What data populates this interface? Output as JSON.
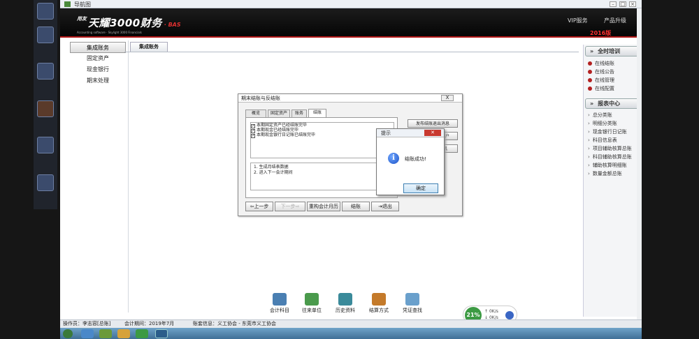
{
  "window": {
    "title": "导航图"
  },
  "banner": {
    "brand_small": "用友",
    "product": "天耀3000财务",
    "edition": "· BAS",
    "tagline": "Accounting software · Skylight 3000 Financials",
    "vip": "VIP服务",
    "upgrade": "产品升级",
    "year": "2016版"
  },
  "left_nav": {
    "items": [
      {
        "label": "集成账务",
        "active": true
      },
      {
        "label": "固定资产",
        "active": false
      },
      {
        "label": "现金银行",
        "active": false
      },
      {
        "label": "期末处理",
        "active": false
      }
    ]
  },
  "main_tab": {
    "label": "集成账务"
  },
  "right_panel": {
    "section1": {
      "title": "全时培训",
      "items": [
        "在线结账",
        "在线公告",
        "在线管理",
        "在线配置"
      ]
    },
    "section2": {
      "title": "报表中心",
      "items": [
        "总分类账",
        "明细分类账",
        "现金银行日记账",
        "科目信息表",
        "项目辅助核算总账",
        "科目辅助核算总账",
        "辅助核算明细账",
        "数量金额总账"
      ]
    }
  },
  "dialog": {
    "title": "期末结账与反结账",
    "close": "X",
    "tabs": [
      "概览",
      "固定资产",
      "账务",
      "结账"
    ],
    "active_tab": 3,
    "checks": [
      "本期固定资产已经结账完毕",
      "本期现金已经结账完毕",
      "本期现金银行日记账已结账完毕"
    ],
    "steps": [
      "1. 生成月结表数据",
      "2. 进入下一会计期间"
    ],
    "side_buttons": [
      "发布结账退出消息",
      "强制关闭其他用户",
      "其它查账计算机"
    ],
    "nav_buttons": {
      "prev": "上一步",
      "next": "下一步",
      "reset": "重构会计月历",
      "close_books": "结账",
      "exit": "退出"
    }
  },
  "message_box": {
    "title": "提示",
    "close": "✕",
    "icon": "info-icon",
    "text": "结账成功!",
    "ok": "确定"
  },
  "bottom_tools": [
    {
      "label": "会计科目",
      "icon": "accounting-subject-icon",
      "color": "#4a7fb2"
    },
    {
      "label": "往来单位",
      "icon": "business-unit-icon",
      "color": "#4a9a4c"
    },
    {
      "label": "历史资料",
      "icon": "history-icon",
      "color": "#3a8a9a"
    },
    {
      "label": "结算方式",
      "icon": "settlement-icon",
      "color": "#c47a2a"
    },
    {
      "label": "凭证查找",
      "icon": "voucher-search-icon",
      "color": "#6aa0cc"
    }
  ],
  "status_bar": {
    "operator": "操作员：李志容[总账]",
    "period": "会计期间：2019年7月",
    "account_info": "账套信息：义工协会 - 东莞市义工协会"
  },
  "net_widget": {
    "percent": "21%",
    "up": "0K/s",
    "down": "0K/s"
  },
  "colors": {
    "banner_red": "#b21818",
    "ok_blue": "#3c7fb1",
    "info_blue": "#1b52c6"
  }
}
